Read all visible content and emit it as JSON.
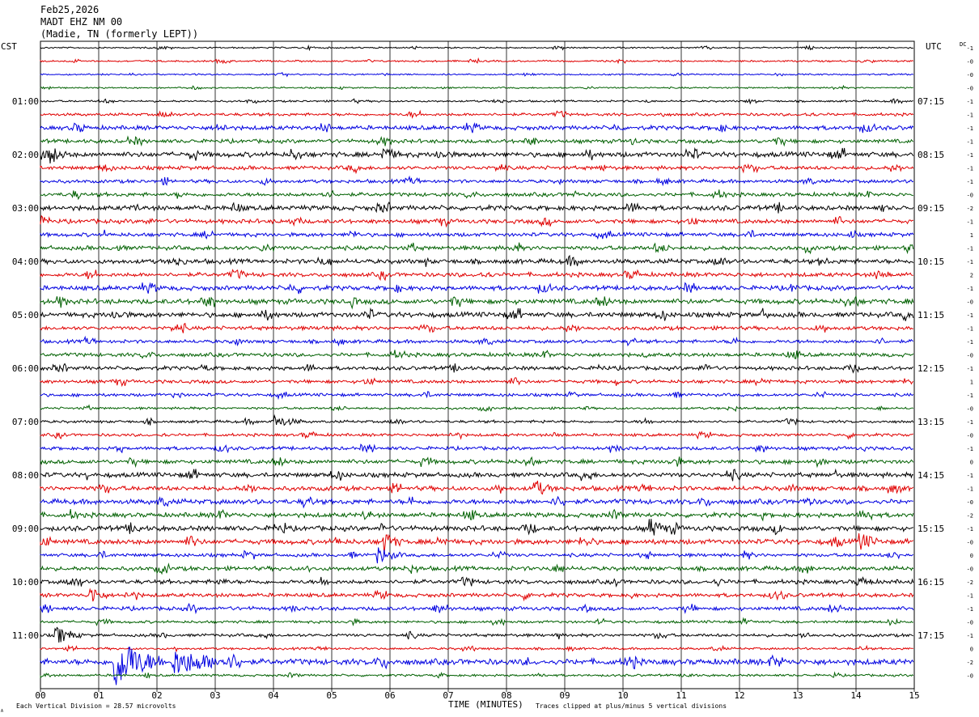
{
  "header": {
    "date": "Feb25,2026",
    "station": "MADT EHZ NM 00",
    "location": "(Madie, TN (formerly LEPT))"
  },
  "left_timezone": "CST",
  "right_timezone": "UTC",
  "dc_label": "DC",
  "footer": {
    "scale_note": "Each Vertical Division = 28.57 microvolts",
    "x_axis_title": "TIME (MINUTES)",
    "clip_note": "Traces clipped at plus/minus 5 vertical divisions",
    "corner_mark": "A"
  },
  "colors": {
    "trace_cycle": [
      "#000000",
      "#e00000",
      "#0000e0",
      "#006000"
    ],
    "grid": "#000000",
    "background": "#ffffff"
  },
  "chart_data": {
    "type": "line",
    "subtype": "helicorder",
    "x_range_minutes": [
      0,
      15
    ],
    "x_ticks": [
      "00",
      "01",
      "02",
      "03",
      "04",
      "05",
      "06",
      "07",
      "08",
      "09",
      "10",
      "11",
      "12",
      "13",
      "14",
      "15"
    ],
    "minutes_per_line": 15,
    "line_count": 48,
    "left_hour_labels": [
      {
        "line": 4,
        "label": "01:00"
      },
      {
        "line": 8,
        "label": "02:00"
      },
      {
        "line": 12,
        "label": "03:00"
      },
      {
        "line": 16,
        "label": "04:00"
      },
      {
        "line": 20,
        "label": "05:00"
      },
      {
        "line": 24,
        "label": "06:00"
      },
      {
        "line": 28,
        "label": "07:00"
      },
      {
        "line": 32,
        "label": "08:00"
      },
      {
        "line": 36,
        "label": "09:00"
      },
      {
        "line": 40,
        "label": "10:00"
      },
      {
        "line": 44,
        "label": "11:00"
      }
    ],
    "right_hour_labels": [
      {
        "line": 4,
        "label": "07:15"
      },
      {
        "line": 8,
        "label": "08:15"
      },
      {
        "line": 12,
        "label": "09:15"
      },
      {
        "line": 16,
        "label": "10:15"
      },
      {
        "line": 20,
        "label": "11:15"
      },
      {
        "line": 24,
        "label": "12:15"
      },
      {
        "line": 28,
        "label": "13:15"
      },
      {
        "line": 32,
        "label": "14:15"
      },
      {
        "line": 36,
        "label": "15:15"
      },
      {
        "line": 40,
        "label": "16:15"
      },
      {
        "line": 44,
        "label": "17:15"
      }
    ],
    "dc_offsets": [
      "-1",
      "-0",
      "-0",
      "-0",
      "-1",
      "-1",
      "-1",
      "-1",
      "-1",
      "-1",
      "-1",
      "-0",
      "-2",
      "-1",
      "1",
      "-1",
      "-1",
      "2",
      "-1",
      "-0",
      "-1",
      "-1",
      "-1",
      "-0",
      "-1",
      "1",
      "-1",
      "-0",
      "-1",
      "-0",
      "-1",
      "0",
      "-1",
      "-1",
      "-0",
      "-2",
      "-1",
      "-0",
      "0",
      "-0",
      "-2",
      "-1",
      "-1",
      "-0",
      "-1",
      "0",
      "-2",
      "-0"
    ],
    "line_noise_levels": [
      0.8,
      0.9,
      0.8,
      0.8,
      1.0,
      1.5,
      2.2,
      2.0,
      2.6,
      2.0,
      1.8,
      2.0,
      2.5,
      2.2,
      2.0,
      2.2,
      2.4,
      2.2,
      2.4,
      2.6,
      2.6,
      2.0,
      1.8,
      2.0,
      2.0,
      1.8,
      1.6,
      1.2,
      1.4,
      1.5,
      1.8,
      2.2,
      2.4,
      2.4,
      2.6,
      2.4,
      2.6,
      2.6,
      1.8,
      2.2,
      2.2,
      2.0,
      2.0,
      1.4,
      1.6,
      1.2,
      3.0,
      1.2
    ],
    "events": [
      {
        "line": 41,
        "minute": 0.9,
        "amplitude": 4,
        "duration_minutes": 0.25
      },
      {
        "line": 44,
        "minute": 0.3,
        "amplitude": 4,
        "duration_minutes": 0.4
      },
      {
        "line": 46,
        "minute": 1.3,
        "amplitude": 12,
        "duration_minutes": 0.8
      },
      {
        "line": 46,
        "minute": 2.3,
        "amplitude": 6,
        "duration_minutes": 1.2
      },
      {
        "line": 37,
        "minute": 5.9,
        "amplitude": 5,
        "duration_minutes": 0.3
      },
      {
        "line": 38,
        "minute": 5.8,
        "amplitude": 4,
        "duration_minutes": 0.4
      },
      {
        "line": 33,
        "minute": 8.5,
        "amplitude": 4,
        "duration_minutes": 0.3
      },
      {
        "line": 36,
        "minute": 10.5,
        "amplitude": 4,
        "duration_minutes": 0.3
      },
      {
        "line": 37,
        "minute": 14.1,
        "amplitude": 4,
        "duration_minutes": 0.3
      },
      {
        "line": 28,
        "minute": 4.0,
        "amplitude": 3,
        "duration_minutes": 0.5
      },
      {
        "line": 8,
        "minute": 0.2,
        "amplitude": 3,
        "duration_minutes": 0.3
      },
      {
        "line": 8,
        "minute": 5.9,
        "amplitude": 3,
        "duration_minutes": 0.3
      }
    ]
  }
}
